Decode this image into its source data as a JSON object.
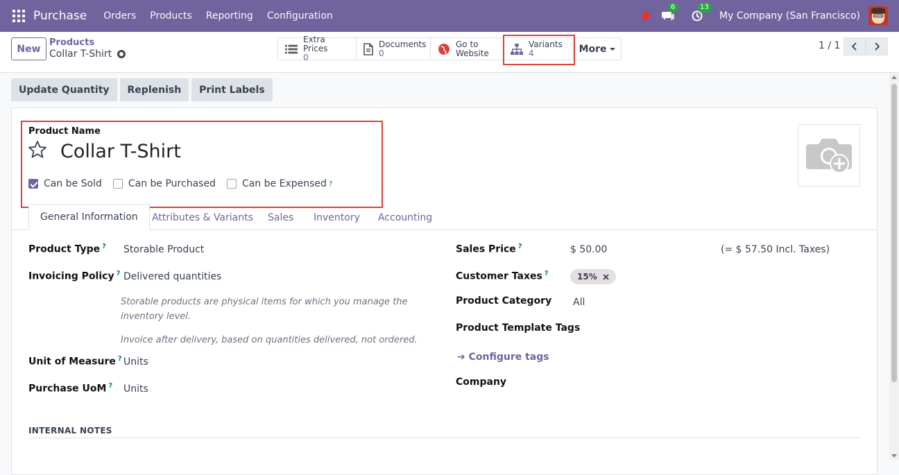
{
  "nav": {
    "brand": "Purchase",
    "menus": [
      "Orders",
      "Products",
      "Reporting",
      "Configuration"
    ],
    "messages_count": "6",
    "activities_count": "13",
    "company": "My Company (San Francisco)"
  },
  "control": {
    "new_label": "New",
    "breadcrumb_parent": "Products",
    "breadcrumb_current": "Collar T-Shirt",
    "stats": [
      {
        "label": "Extra Prices",
        "value": "0"
      },
      {
        "label": "Documents",
        "value": "0"
      },
      {
        "label": "Go to",
        "value": "Website"
      },
      {
        "label": "Variants",
        "value": "4"
      }
    ],
    "more_label": "More",
    "pager": "1 / 1"
  },
  "actions": [
    "Update Quantity",
    "Replenish",
    "Print Labels"
  ],
  "product": {
    "name_label": "Product Name",
    "name": "Collar T-Shirt",
    "checkboxes": [
      {
        "label": "Can be Sold",
        "checked": true
      },
      {
        "label": "Can be Purchased",
        "checked": false
      },
      {
        "label": "Can be Expensed",
        "checked": false
      }
    ],
    "help_mark": "?"
  },
  "tabs": [
    "General Information",
    "Attributes & Variants",
    "Sales",
    "Inventory",
    "Accounting"
  ],
  "fields": {
    "product_type_label": "Product Type",
    "product_type": "Storable Product",
    "invoicing_policy_label": "Invoicing Policy",
    "invoicing_policy": "Delivered quantities",
    "help_storable": "Storable products are physical items for which you manage the inventory level.",
    "help_invoice": "Invoice after delivery, based on quantities delivered, not ordered.",
    "uom_label": "Unit of Measure",
    "uom": "Units",
    "purchase_uom_label": "Purchase UoM",
    "purchase_uom": "Units",
    "sales_price_label": "Sales Price",
    "sales_price": "$ 50.00",
    "incl_taxes": "(= $ 57.50 Incl. Taxes)",
    "customer_taxes_label": "Customer Taxes",
    "customer_tax_tag": "15%",
    "category_label": "Product Category",
    "category": "All",
    "template_tags_label": "Product Template Tags",
    "configure_tags": "Configure tags",
    "company_label": "Company",
    "internal_notes": "INTERNAL NOTES"
  },
  "colors": {
    "brand": "#71639e",
    "highlight": "#d9423a",
    "badge": "#28a745"
  }
}
